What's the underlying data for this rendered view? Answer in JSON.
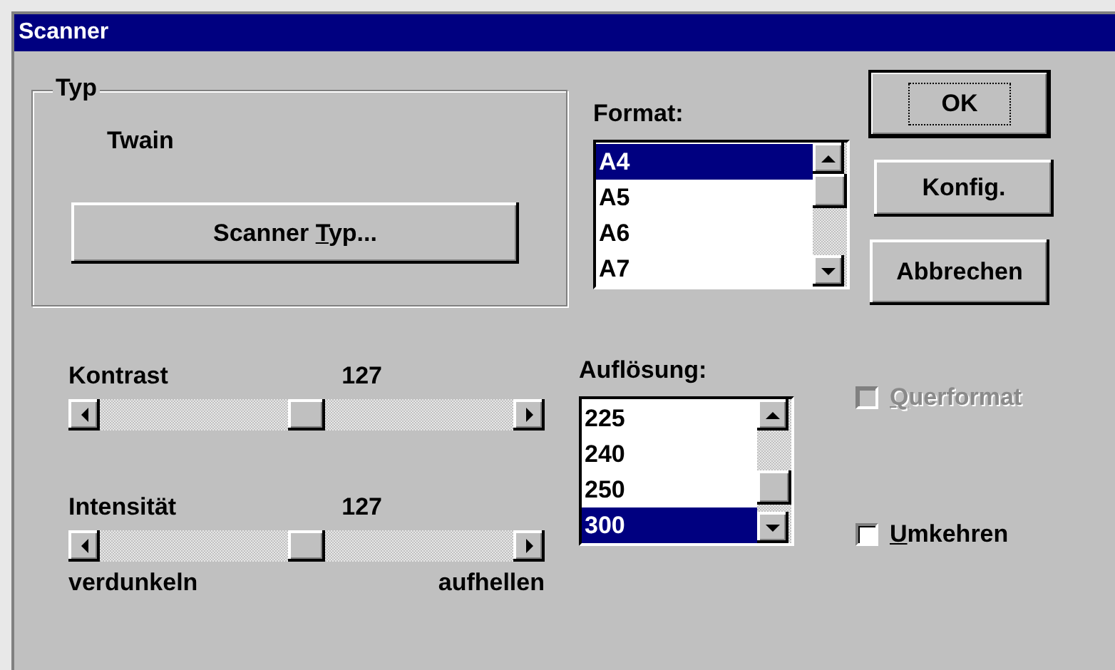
{
  "window": {
    "title": "Scanner"
  },
  "type_group": {
    "legend": "Typ",
    "value": "Twain",
    "button": {
      "before": "Scanner ",
      "key": "T",
      "after": "yp..."
    }
  },
  "format": {
    "label": "Format:",
    "items": [
      {
        "text": "A4",
        "selected": true
      },
      {
        "text": "A5",
        "selected": false
      },
      {
        "text": "A6",
        "selected": false
      },
      {
        "text": "A7",
        "selected": false
      }
    ]
  },
  "buttons": [
    {
      "label": "OK",
      "default": true
    },
    {
      "label": "Konfig.",
      "default": false
    },
    {
      "label": "Abbrechen",
      "default": false
    }
  ],
  "sliders": [
    {
      "label": "Kontrast",
      "reading": "127",
      "level": 0.5
    },
    {
      "label": "Intensität",
      "reading": "127",
      "level": 0.5
    }
  ],
  "slider_ends": {
    "left": "verdunkeln",
    "right": "aufhellen"
  },
  "resolution": {
    "label": "Auflösung:",
    "items": [
      {
        "text": "225",
        "selected": false
      },
      {
        "text": "240",
        "selected": false
      },
      {
        "text": "250",
        "selected": false
      },
      {
        "text": "300",
        "selected": true
      }
    ]
  },
  "checkboxes": [
    {
      "key": "Q",
      "after": "uerformat",
      "checked": false,
      "disabled": true
    },
    {
      "key": "U",
      "after": "mkehren",
      "checked": false,
      "disabled": false
    }
  ]
}
